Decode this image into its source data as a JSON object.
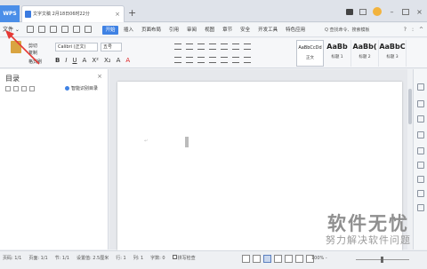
{
  "titlebar": {
    "app_tab": "WPS",
    "doc_tab": "文字文稿 2月18日06时22分",
    "new_tab": "+",
    "tab_close": "×"
  },
  "menubar": {
    "file": "文件 ⌄",
    "start": "开始",
    "items": [
      "插入",
      "页面布局",
      "引用",
      "审阅",
      "视图",
      "章节",
      "安全",
      "开发工具",
      "特色应用"
    ],
    "search": "Q 查找命令、搜索模板",
    "right": [
      "?",
      ":",
      "^"
    ]
  },
  "ribbon": {
    "paste_label": "粘贴",
    "cut_label": "剪切",
    "copy_label": "复制",
    "format_painter": "格式刷",
    "font_name": "Calibri (正文)",
    "font_size": "五号",
    "format_buttons": [
      "B",
      "I",
      "U",
      "A",
      "X²",
      "X₂",
      "A",
      "A"
    ],
    "styles": [
      {
        "preview": "AaBbCcDd",
        "name": "正文"
      },
      {
        "preview": "AaBb",
        "name": "标题 1"
      },
      {
        "preview": "AaBb(",
        "name": "标题 2"
      },
      {
        "preview": "AaBbC",
        "name": "标题 3"
      }
    ]
  },
  "navpane": {
    "title": "目录",
    "close": "×",
    "smart_toc": "智能识别目录"
  },
  "document": {
    "para_mark": "↵"
  },
  "statusbar": {
    "page": "页码: 1/1",
    "pages": "页面: 1/1",
    "section": "节: 1/1",
    "setting": "设置值: 2.5厘米",
    "row": "行: 1",
    "column": "列: 1",
    "words": "字数: 0",
    "spellcheck": "拼写检查",
    "zoom": "100% -"
  },
  "watermark": {
    "title": "软件无忧",
    "subtitle": "努力解决软件问题"
  },
  "colors": {
    "accent": "#3f82e4",
    "arrow": "#e53935"
  }
}
